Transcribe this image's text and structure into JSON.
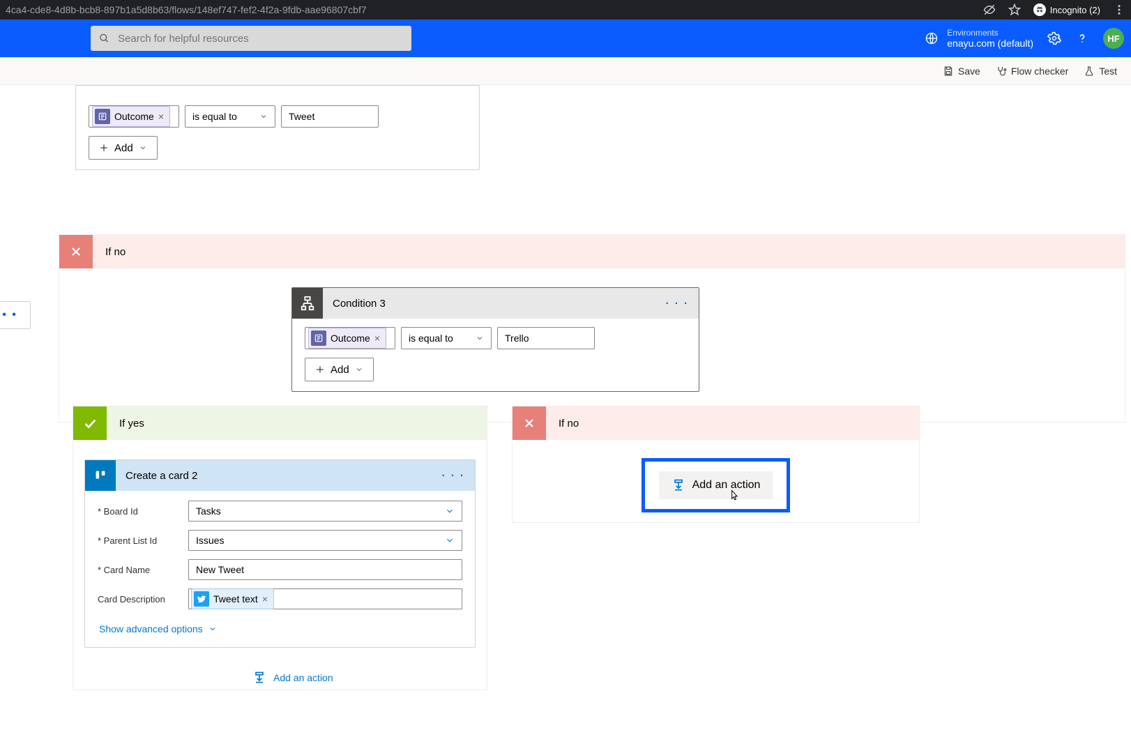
{
  "chrome": {
    "url": "4ca4-cde8-4d8b-bcb8-897b1a5d8b63/flows/148ef747-fef2-4f2a-9fdb-aae96807cbf7",
    "incognito_label": "Incognito (2)"
  },
  "header": {
    "search_placeholder": "Search for helpful resources",
    "env_label": "Environments",
    "env_value": "enayu.com (default)",
    "avatar_initials": "HF"
  },
  "toolbar": {
    "save": "Save",
    "flowchecker": "Flow checker",
    "test": "Test"
  },
  "top_condition": {
    "token": "Outcome",
    "operator": "is equal to",
    "value": "Tweet",
    "add": "Add"
  },
  "branch_labels": {
    "yes": "If yes",
    "no": "If no"
  },
  "condition3": {
    "title": "Condition 3",
    "token": "Outcome",
    "operator": "is equal to",
    "value": "Trello",
    "add": "Add"
  },
  "trello_card": {
    "title": "Create a card 2",
    "fields": {
      "board_label": "* Board Id",
      "board_value": "Tasks",
      "parent_label": "* Parent List Id",
      "parent_value": "Issues",
      "cardname_label": "* Card Name",
      "cardname_value": "New Tweet",
      "desc_label": "Card Description",
      "desc_token": "Tweet text"
    },
    "advanced": "Show advanced options"
  },
  "actions": {
    "add_action": "Add an action"
  }
}
